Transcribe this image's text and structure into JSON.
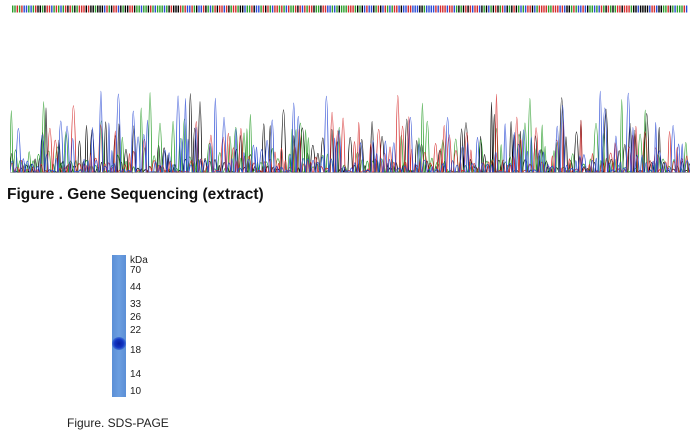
{
  "gene_figure": {
    "caption": "Figure . Gene Sequencing (extract)",
    "trace_colors": [
      "#000000",
      "#2a9d2a",
      "#d42a2a",
      "#2a4ad4"
    ]
  },
  "sds_figure": {
    "caption": "Figure. SDS-PAGE",
    "unit_label": "kDa",
    "markers": [
      "70",
      "44",
      "33",
      "26",
      "22",
      "18",
      "14",
      "10"
    ],
    "band_marker": "18",
    "lane_color": "#5b8fd6",
    "band_color": "#0a1f9e"
  }
}
